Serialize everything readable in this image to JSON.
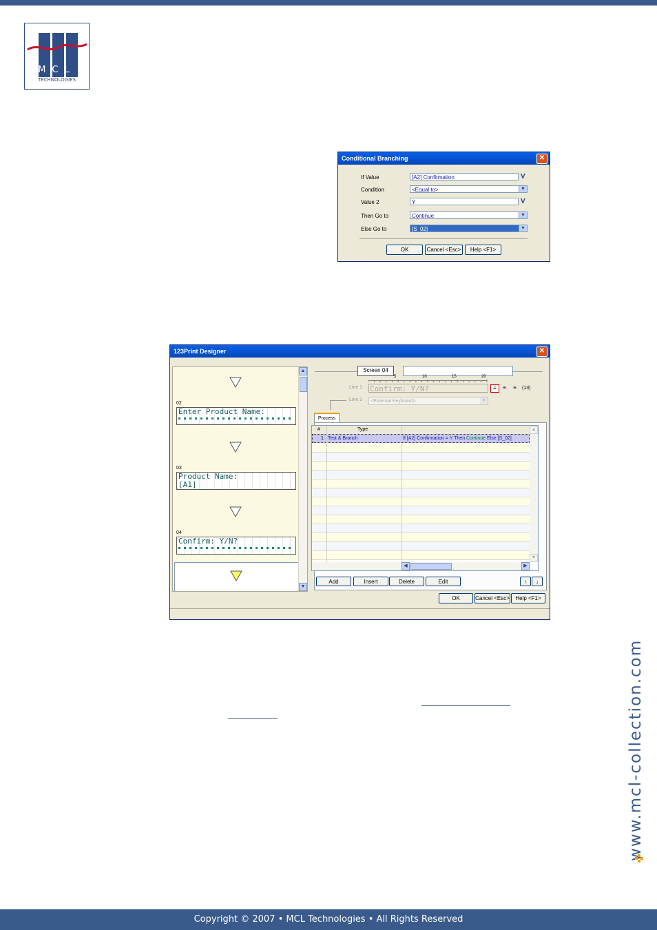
{
  "logo": {
    "letters": "MCL",
    "tagline": "TECHNOLOGIES"
  },
  "side_url": "www.mcl-collection.com",
  "footer": {
    "text": "Copyright © 2007 • MCL Technologies • All Rights Reserved"
  },
  "conditional_dialog": {
    "title": "Conditional Branching",
    "close_label": "✕",
    "fields": [
      {
        "label": "If Value",
        "value": "[A2] Confirmation",
        "kind": "text"
      },
      {
        "label": "Condition",
        "value": "<Equal to>",
        "kind": "dropdown"
      },
      {
        "label": "Value 2",
        "value": "Y",
        "kind": "text"
      },
      {
        "label": "Then Go to",
        "value": "Continue",
        "kind": "dropdown"
      },
      {
        "label": "Else Go to",
        "value": "[S_02]",
        "kind": "dropdown"
      }
    ],
    "v_icon": "V",
    "buttons": {
      "ok": "OK",
      "cancel": "Cancel <Esc>",
      "help": "Help <F1>"
    }
  },
  "designer": {
    "title": "123Print Designer",
    "close_label": "✕",
    "screens": [
      {
        "num": "02",
        "line1": "Enter Product Name:",
        "line2": ""
      },
      {
        "num": "03",
        "line1": "Product Name:",
        "line2": "[A1]"
      },
      {
        "num": "04",
        "line1": "Confirm: Y/N?",
        "line2": ""
      }
    ],
    "screen_label": "Screen 04",
    "screen_name": "",
    "ruler": [
      "5",
      "10",
      "15",
      "20"
    ],
    "line1_label": "Line 1",
    "line1_value": "Confirm: Y/N?",
    "char_count": "(13)",
    "line2_label": "Line 2",
    "line2_value": "<External Keyboard>",
    "tab_process": "Process",
    "grid_headers": [
      "#",
      "Type",
      ""
    ],
    "grid_row": {
      "num": "1",
      "type": "Test & Branch",
      "detail_prefix": "If [A2] Confirmation = Y Then ",
      "detail_then": "Continue",
      "detail_mid": " Else ",
      "detail_else": "[S_02]"
    },
    "buttons": {
      "add": "Add",
      "insert": "Insert",
      "delete": "Delete",
      "edit": "Edit",
      "up": "↑",
      "down": "↓",
      "ok": "OK",
      "cancel": "Cancel <Esc>",
      "help": "Help <F1>"
    },
    "colors": {
      "then_green": "#007a3d",
      "else_blue": "#1a1aa6",
      "selected_row": "#c8c8f0"
    }
  }
}
